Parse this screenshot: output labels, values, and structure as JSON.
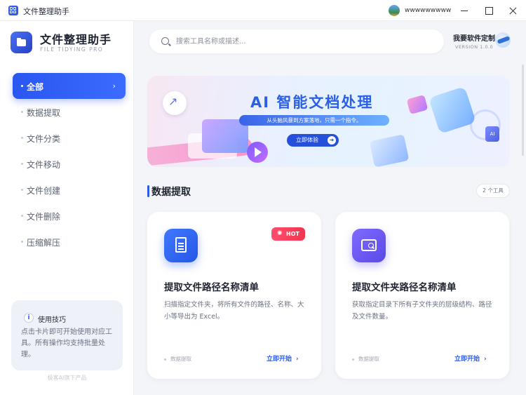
{
  "titlebar": {
    "title": "文件整理助手",
    "user_name": "wwwwwwwww"
  },
  "sidebar": {
    "brand_name": "文件整理助手",
    "brand_sub": "FILE TIDYING PRO",
    "items": [
      {
        "label": "全部",
        "active": true
      },
      {
        "label": "数据提取"
      },
      {
        "label": "文件分类"
      },
      {
        "label": "文件移动"
      },
      {
        "label": "文件创建"
      },
      {
        "label": "文件删除"
      },
      {
        "label": "压缩解压"
      }
    ],
    "tips": {
      "title": "使用技巧",
      "text": "点击卡片即可开始使用对应工具。所有操作均支持批量处理。"
    },
    "footer": "极客AI旗下产品"
  },
  "header": {
    "search_placeholder": "搜索工具名称或描述...",
    "custom_label": "我要软件定制",
    "version": "VERSION 1.0.0"
  },
  "banner": {
    "title": "AI 智能文档处理",
    "subtitle": "从头脑风暴到方案落地，只需一个指令。",
    "button_label": "立即体验",
    "ai_tag": "AI"
  },
  "section": {
    "title": "数据提取",
    "count": "2 个工具"
  },
  "cards": [
    {
      "title": "提取文件路径名称清单",
      "desc": "扫描指定文件夹，将所有文件的路径、名称、大小等导出为 Excel。",
      "category": "数据提取",
      "action": "立即开始",
      "badge": "HOT"
    },
    {
      "title": "提取文件夹路径名称清单",
      "desc": "获取指定目录下所有子文件夹的层级结构、路径及文件数量。",
      "category": "数据提取",
      "action": "立即开始"
    }
  ],
  "colors": {
    "accent": "#2f5bea",
    "hot": "#f0364f",
    "purple_icon": "#6a58f2"
  }
}
